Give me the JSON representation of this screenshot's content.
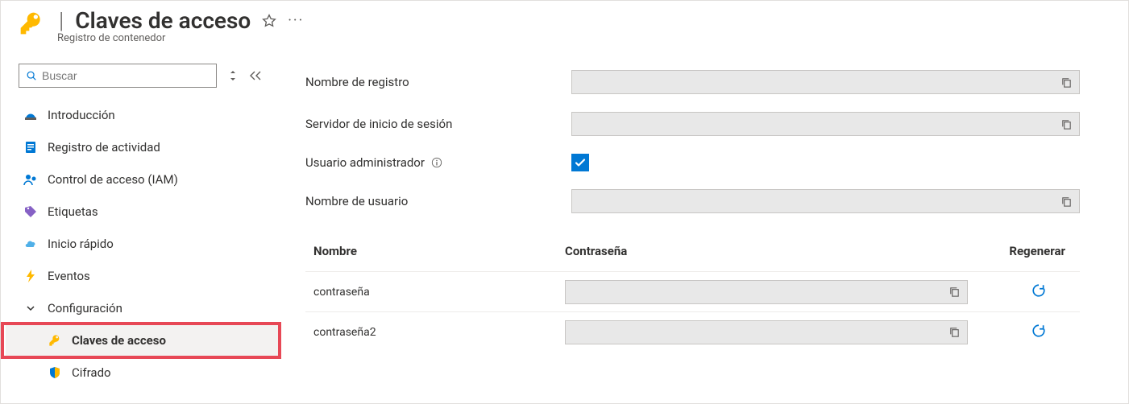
{
  "header": {
    "title": "Claves de acceso",
    "subtitle": "Registro de contenedor"
  },
  "search": {
    "placeholder": "Buscar"
  },
  "sidebar": {
    "items": [
      {
        "label": "Introducción"
      },
      {
        "label": "Registro de actividad"
      },
      {
        "label": "Control de acceso (IAM)"
      },
      {
        "label": "Etiquetas"
      },
      {
        "label": "Inicio rápido"
      },
      {
        "label": "Eventos"
      }
    ],
    "section": "Configuración",
    "subitems": [
      {
        "label": "Claves de acceso"
      },
      {
        "label": "Cifrado"
      }
    ]
  },
  "form": {
    "registry_name_label": "Nombre de registro",
    "login_server_label": "Servidor de inicio de sesión",
    "admin_user_label": "Usuario administrador",
    "admin_user_checked": true,
    "username_label": "Nombre de usuario"
  },
  "table": {
    "headers": {
      "name": "Nombre",
      "password": "Contraseña",
      "regen": "Regenerar"
    },
    "rows": [
      {
        "name": "contraseña"
      },
      {
        "name": "contraseña2"
      }
    ]
  }
}
